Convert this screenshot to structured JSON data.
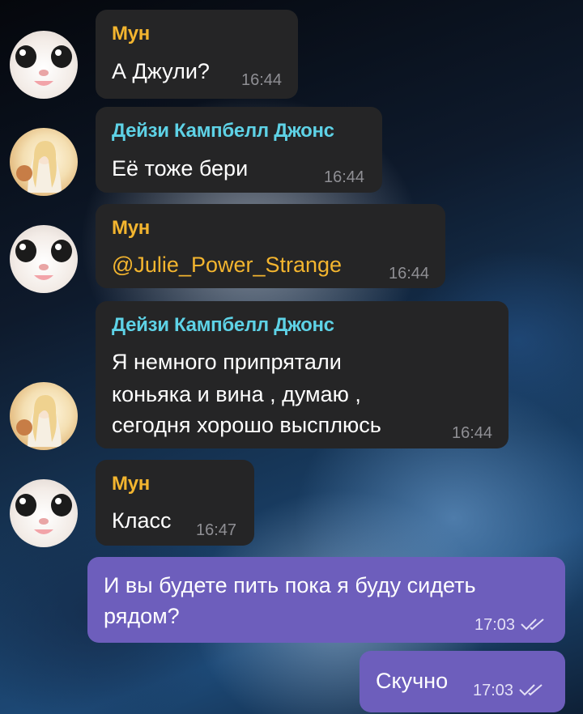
{
  "chat": {
    "messages": [
      {
        "sender": "Мун",
        "text": "А Джули?",
        "time": "16:44"
      },
      {
        "sender": "Дейзи Кампбелл Джонс",
        "text": "Её тоже бери",
        "time": "16:44"
      },
      {
        "sender": "Мун",
        "text": "@Julie_Power_Strange",
        "time": "16:44"
      },
      {
        "sender": "Дейзи Кампбелл Джонс",
        "text_lines": [
          "Я немного припрятали",
          "коньяка и вина , думаю ,",
          "сегодня хорошо высплюсь"
        ],
        "time": "16:44"
      },
      {
        "sender": "Мун",
        "text": "Класс",
        "time": "16:47"
      }
    ],
    "outgoing": [
      {
        "text_lines": [
          "И вы будете пить пока я буду сидеть",
          "рядом?"
        ],
        "time": "17:03",
        "status": "read-double-check-icon"
      },
      {
        "text": "Скучно",
        "time": "17:03",
        "status": "read-double-check-icon"
      }
    ]
  },
  "colors": {
    "incoming_bubble": "#252526",
    "outgoing_bubble": "#6d5ebc",
    "mun_name": "#f3b52f",
    "daisy_name": "#5ed2e6",
    "mention": "#f3b52f"
  }
}
